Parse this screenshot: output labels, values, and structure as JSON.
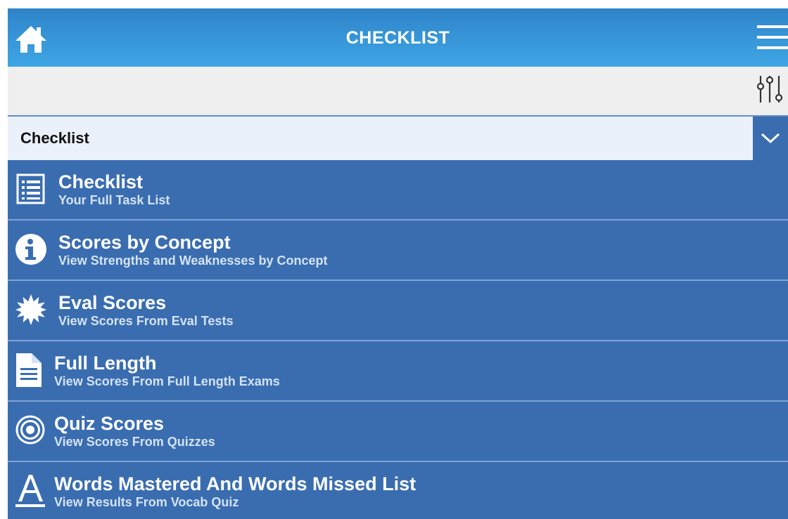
{
  "header": {
    "title": "CHECKLIST",
    "home_icon": "home-icon",
    "menu_icon": "hamburger-menu-icon"
  },
  "toolbar": {
    "filter_icon": "sliders-filter-icon"
  },
  "selector": {
    "value": "Checklist",
    "toggle_icon": "chevron-down-icon"
  },
  "colors": {
    "header_gradient_top": "#2f84c9",
    "header_gradient_bottom": "#3ea6e4",
    "list_background": "#3a6db0",
    "select_background": "#ebf1fb",
    "toolbar_background": "#efefef",
    "text_light": "#ffffff"
  },
  "menu": [
    {
      "title": "Checklist",
      "subtitle": "Your Full Task List",
      "icon": "task-list-icon"
    },
    {
      "title": "Scores by Concept",
      "subtitle": "View Strengths and Weaknesses by Concept",
      "icon": "info-icon"
    },
    {
      "title": "Eval Scores",
      "subtitle": "View Scores From Eval Tests",
      "icon": "starburst-icon"
    },
    {
      "title": "Full Length",
      "subtitle": "View Scores From Full Length Exams",
      "icon": "document-icon"
    },
    {
      "title": "Quiz Scores",
      "subtitle": "View Scores From Quizzes",
      "icon": "target-icon"
    },
    {
      "title": "Words Mastered And Words Missed List",
      "subtitle": "View Results From Vocab Quiz",
      "icon": "letter-a-icon"
    }
  ]
}
